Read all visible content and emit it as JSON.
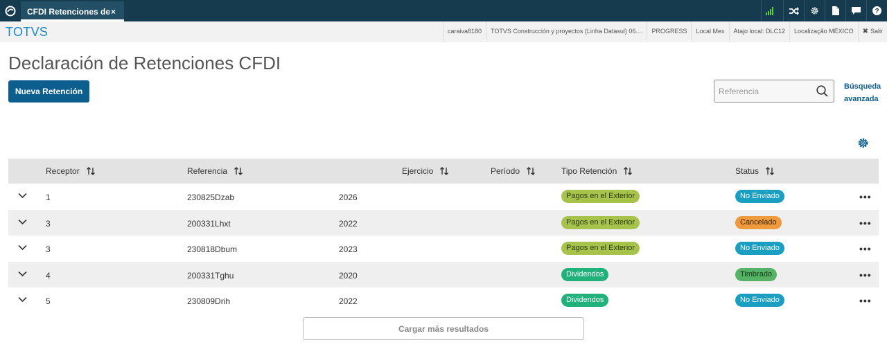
{
  "topbar": {
    "tab_label": "CFDI Retenciones de",
    "tab_close": "×",
    "signal_text": "0l"
  },
  "infobar": {
    "brand": "TOTVS",
    "items": [
      "caraiva8180",
      "TOTVS Construcción y proyectos (Linha Datasul) 06....",
      "PROGRESS",
      "Local Mex",
      "Atajo local: DLC12",
      "Localização MÉXICO"
    ],
    "exit_label": "Salir"
  },
  "page": {
    "title": "Declaración de Retenciones CFDI",
    "new_button": "Nueva Retención",
    "search_placeholder": "Referencia",
    "advanced_line1": "Búsqueda",
    "advanced_line2": "avanzada",
    "load_more": "Cargar más resultados"
  },
  "table": {
    "headers": [
      "Receptor",
      "Referencia",
      "Ejercicio",
      "Período",
      "Tipo Retención",
      "Status"
    ],
    "rows": [
      {
        "receptor": "1",
        "referencia": "230825Dzab",
        "ejercicio": "2026",
        "tipo": "Pagos en el Exterior",
        "status": "No Enviado"
      },
      {
        "receptor": "3",
        "referencia": "200331Lhxt",
        "ejercicio": "2022",
        "tipo": "Pagos en el Exterior",
        "status": "Cancelado"
      },
      {
        "receptor": "3",
        "referencia": "230818Dbum",
        "ejercicio": "2023",
        "tipo": "Pagos en el Exterior",
        "status": "No Enviado"
      },
      {
        "receptor": "4",
        "referencia": "200331Tghu",
        "ejercicio": "2020",
        "tipo": "Dividendos",
        "status": "Timbrado"
      },
      {
        "receptor": "5",
        "referencia": "230809Drih",
        "ejercicio": "2022",
        "tipo": "Dividendos",
        "status": "No Enviado"
      }
    ],
    "more_actions": "•••"
  },
  "colors": {
    "Pagos en el Exterior": {
      "bg": "#a8c34b",
      "fg": "#2c3a10"
    },
    "Dividendos": {
      "bg": "#20b27a",
      "fg": "#ffffff"
    },
    "No Enviado": {
      "bg": "#1a9fc2",
      "fg": "#ffffff"
    },
    "Cancelado": {
      "bg": "#ef9a3c",
      "fg": "#3a2200"
    },
    "Timbrado": {
      "bg": "#56b365",
      "fg": "#143a1a"
    }
  }
}
